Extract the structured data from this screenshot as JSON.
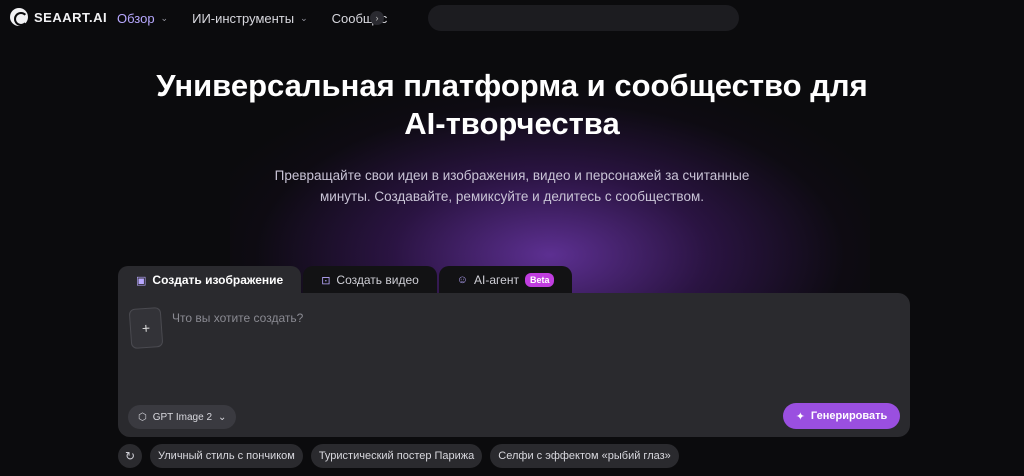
{
  "header": {
    "logo_text": "SEAART.AI",
    "nav": [
      {
        "label": "Обзор",
        "active": true
      },
      {
        "label": "ИИ-инструменты",
        "active": false
      },
      {
        "label": "Сообщес",
        "active": false
      }
    ],
    "search": {
      "placeholder": ""
    }
  },
  "hero": {
    "title_line1": "Универсальная платформа и сообщество для",
    "title_line2": "AI-творчества",
    "subtitle_line1": "Превращайте свои идеи в изображения, видео и персонажей за считанные",
    "subtitle_line2": "минуты. Создавайте, ремиксуйте и делитесь с сообществом."
  },
  "tabs": [
    {
      "label": "Создать изображение",
      "icon": "image-icon",
      "active": true
    },
    {
      "label": "Создать видео",
      "icon": "video-icon",
      "active": false
    },
    {
      "label": "AI-агент",
      "icon": "agent-icon",
      "badge": "Beta",
      "active": false
    }
  ],
  "prompt": {
    "placeholder": "Что вы хотите создать?",
    "value": "",
    "add_label": "+"
  },
  "model_selector": {
    "label": "GPT Image 2"
  },
  "generate_button": {
    "label": "Генерировать"
  },
  "suggestions": [
    "Уличный стиль с пончиком",
    "Туристический постер Парижа",
    "Селфи с эффектом «рыбий глаз»"
  ],
  "colors": {
    "accent": "#9a4fe0",
    "active_nav": "#b7a8ff",
    "beta_badge": "#c03de0",
    "panel": "#2a2a2e",
    "background": "#0b0b0d"
  }
}
